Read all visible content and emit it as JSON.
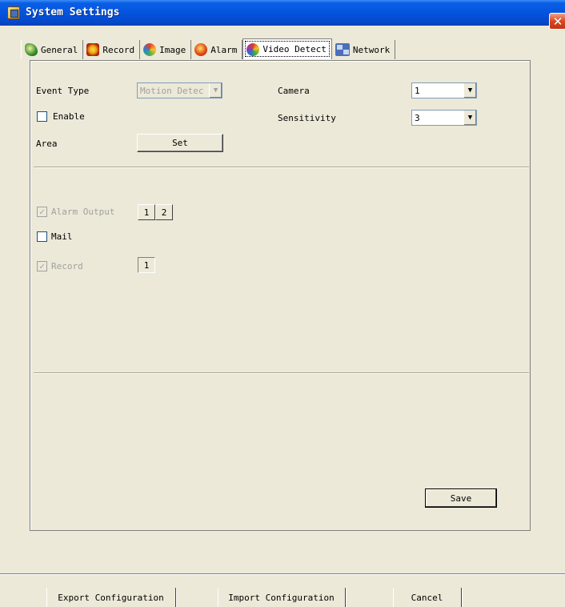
{
  "window": {
    "title": "System Settings",
    "close_glyph": "✕"
  },
  "tabs": [
    {
      "label": "General",
      "icon": "general-icon"
    },
    {
      "label": "Record",
      "icon": "record-icon"
    },
    {
      "label": "Image",
      "icon": "image-icon"
    },
    {
      "label": "Alarm",
      "icon": "alarm-icon"
    },
    {
      "label": "Video Detect",
      "icon": "video-detect-icon",
      "active": true
    },
    {
      "label": "Network",
      "icon": "network-icon"
    }
  ],
  "form": {
    "event_type_label": "Event Type",
    "event_type_value": "Motion Detec",
    "camera_label": "Camera",
    "camera_value": "1",
    "enable_label": "Enable",
    "enable_checked": false,
    "sensitivity_label": "Sensitivity",
    "sensitivity_value": "3",
    "area_label": "Area",
    "set_button": "Set"
  },
  "actions": {
    "alarm_output_label": "Alarm Output",
    "alarm_output_checked": true,
    "alarm_channels": [
      "1",
      "2"
    ],
    "mail_label": "Mail",
    "mail_checked": false,
    "record_label": "Record",
    "record_checked": true,
    "record_channels": [
      "1"
    ]
  },
  "save_button": "Save",
  "footer": {
    "export_button": "Export Configuration",
    "import_button": "Import Configuration",
    "cancel_button": "Cancel"
  },
  "glyphs": {
    "dropdown_arrow": "▼",
    "checkmark": "✓"
  },
  "colors": {
    "titlebar": "#0454dd",
    "window_bg": "#ece9d8",
    "disabled_text": "#a0a0a0"
  }
}
